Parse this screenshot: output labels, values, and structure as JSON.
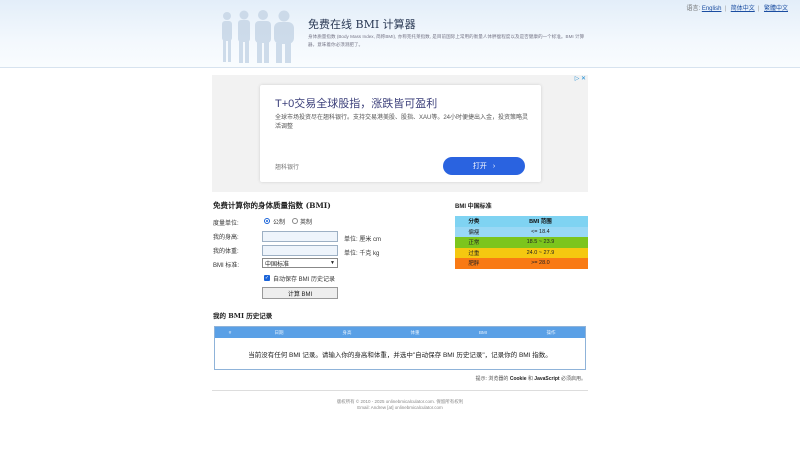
{
  "header": {
    "language_label": "语言:",
    "languages": [
      "English",
      "简体中文",
      "繁體中文"
    ],
    "title": "免费在线 BMI 计算器",
    "description": "身体质量指数 (Body Mass Index, 简称BMI), 亦称克托莱指数, 是目前国际上常用的衡量人体胖瘦程度以及是否健康的一个标准。BMI 计算器，意味着你必须测肥了。"
  },
  "ad": {
    "badge": "▷ ✕",
    "headline": "T+0交易全球股指，涨跌皆可盈利",
    "body": "全球市场投资尽在翘科银行。支持交易港美股、股指、XAU等。24小时便捷出入金，投资策略灵活调整",
    "brand": "翘科银行",
    "button_label": "打开"
  },
  "form": {
    "title": "免费计算你的身体质量指数 (BMI)",
    "unit_label": "度量单位:",
    "unit_options": [
      "公制",
      "英制"
    ],
    "height_label": "我的身高:",
    "height_value": "",
    "height_unit": "单位: 厘米 cm",
    "weight_label": "我的体重:",
    "weight_value": "",
    "weight_unit": "单位: 千克 kg",
    "standard_label": "BMI 标准:",
    "standard_value": "中国标准",
    "autosave_label": "自动保存 BMI 历史记录",
    "calc_button": "计算 BMI"
  },
  "standard": {
    "title": "BMI 中国标准",
    "headers": [
      "分类",
      "BMI 范围"
    ],
    "rows": [
      {
        "category": "偏瘦",
        "range": "<= 18.4",
        "color": "#99d8f5"
      },
      {
        "category": "正常",
        "range": "18.5 ~ 23.9",
        "color": "#7cc51d"
      },
      {
        "category": "过重",
        "range": "24.0 ~ 27.9",
        "color": "#f5c810"
      },
      {
        "category": "肥胖",
        "range": ">= 28.0",
        "color": "#f97a14"
      }
    ]
  },
  "history": {
    "title": "我的 BMI 历史记录",
    "columns": [
      "#",
      "日期",
      "身高",
      "体重",
      "BMI",
      "操作"
    ],
    "empty_message": "当前没有任何 BMI 记录。请输入你的身高和体重，并选中\"自动保存 BMI 历史记录\"，记录你的 BMI 指数。",
    "note_prefix": "提示: 浏览器的",
    "note_cookie": "Cookie",
    "note_and": "和",
    "note_js": "JavaScript",
    "note_suffix": "必须启用。"
  },
  "footer": {
    "line1": "版权所有 © 2010 - 2025 onlinebmicalculator.com. 保留所有权利",
    "line2": "Email: Andrew [at] onlinebmicalculator.com"
  }
}
